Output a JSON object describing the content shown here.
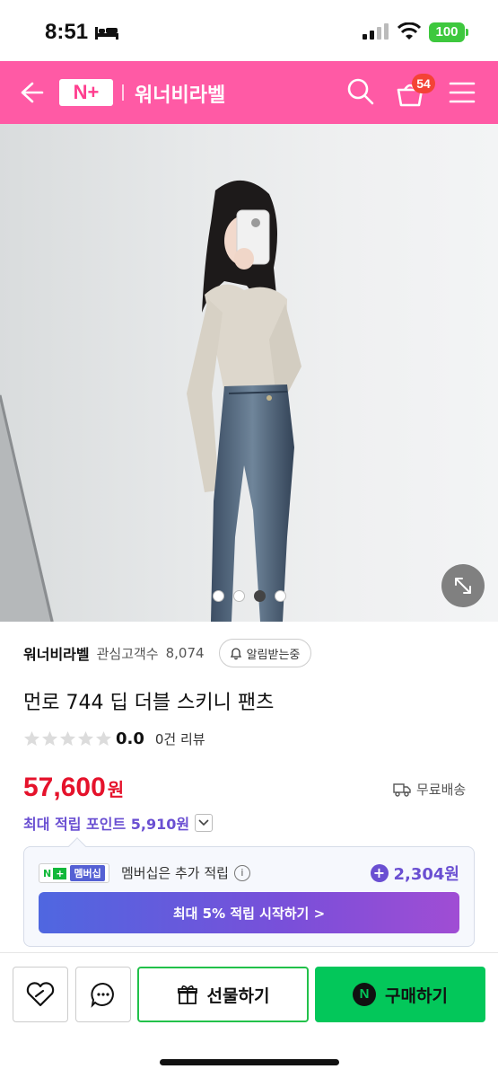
{
  "status_bar": {
    "time": "8:51",
    "battery": "100"
  },
  "header": {
    "logo": "N+",
    "store_name": "워너비라벨",
    "cart_count": "54"
  },
  "gallery": {
    "image_count": 4,
    "active_index": 2
  },
  "seller": {
    "name": "워너비라벨",
    "follower_label": "관심고객수",
    "follower_count": "8,074",
    "notify_label": "알림받는중"
  },
  "product": {
    "name": "먼로 744 딥 더블 스키니 팬츠"
  },
  "rating": {
    "score": "0.0",
    "stars_filled": 0,
    "stars_total": 5,
    "review_text": "0건 리뷰"
  },
  "price": {
    "amount": "57,600",
    "unit": "원",
    "shipping": "무료배송"
  },
  "points": {
    "label": "최대 적립 포인트 5,910원"
  },
  "membership": {
    "badge_n": "N",
    "badge_plus": "+",
    "badge_label": "멤버십",
    "description": "멤버십은 추가 적립",
    "info": "i",
    "bonus": "2,304원",
    "cta": "최대 5% 적립 시작하기 >"
  },
  "bottom_bar": {
    "gift_label": "선물하기",
    "buy_label": "구매하기",
    "buy_icon": "N"
  },
  "colors": {
    "brand_pink": "#ff5aa5",
    "price_red": "#e5122b",
    "naver_green": "#03c75a",
    "points_purple": "#6a4fd2"
  }
}
